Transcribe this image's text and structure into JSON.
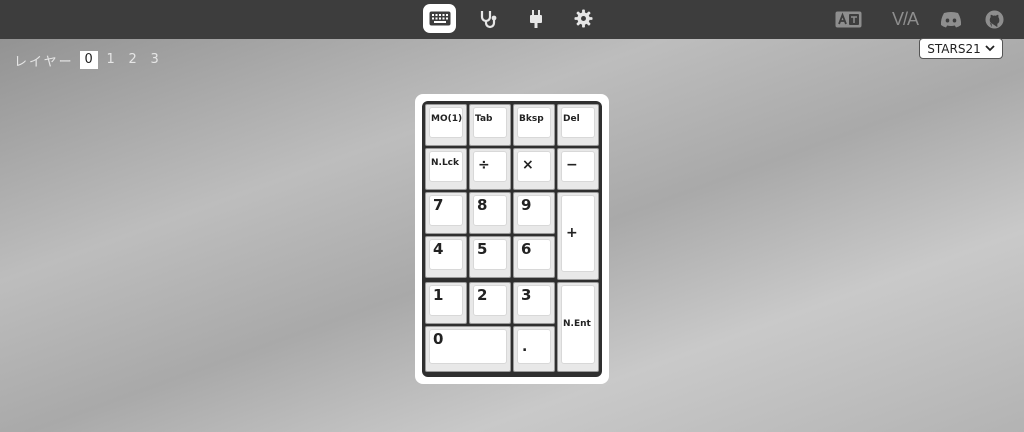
{
  "nav": {
    "tabs": [
      {
        "name": "keyboard-icon",
        "active": true
      },
      {
        "name": "stethoscope-icon",
        "active": false
      },
      {
        "name": "usb-plug-icon",
        "active": false
      },
      {
        "name": "gear-icon",
        "active": false
      }
    ],
    "right": {
      "language_icon": "language-icon",
      "via_logo": "V/A",
      "discord_icon": "discord-icon",
      "github_icon": "github-icon"
    }
  },
  "layers": {
    "label": "レイヤー",
    "items": [
      "0",
      "1",
      "2",
      "3"
    ],
    "active": "0"
  },
  "device": {
    "selected": "STARS21"
  },
  "keyboard": {
    "keys": {
      "mo1": "MO(1)",
      "tab": "Tab",
      "bksp": "Bksp",
      "del": "Del",
      "nlck": "N.Lck",
      "div": "÷",
      "mul": "×",
      "minus": "−",
      "k7": "7",
      "k8": "8",
      "k9": "9",
      "plus": "+",
      "k4": "4",
      "k5": "5",
      "k6": "6",
      "k1": "1",
      "k2": "2",
      "k3": "3",
      "nent": "N.Ent",
      "k0": "0",
      "dot": "."
    }
  }
}
